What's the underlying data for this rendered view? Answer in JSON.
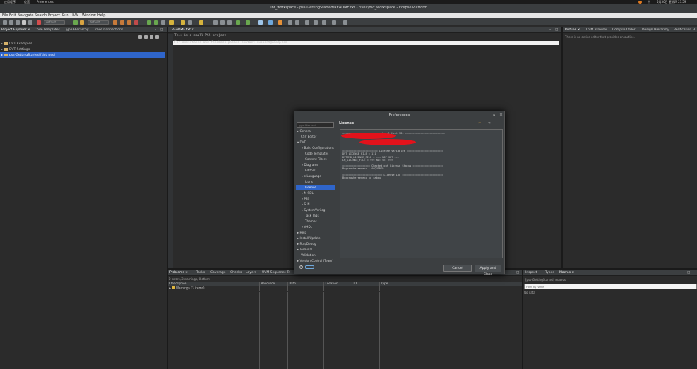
{
  "system_bar": {
    "left_items": [
      "应用程序",
      "位置",
      "Preferences"
    ],
    "right_items": [
      "中",
      "5月30日 星期四 23∶59"
    ]
  },
  "window": {
    "title": "lint_workspace - pss-GettingStarted/README.txt - riveit/dvt_workspace - Eclipse Platform"
  },
  "menu": [
    "File",
    "Edit",
    "Navigate",
    "Search",
    "Project",
    "Run",
    "UVM",
    "Window",
    "Help"
  ],
  "toolbar": {
    "combo_left": "default",
    "combo_mid": "default"
  },
  "left_panel": {
    "tabs": [
      "Project Explorer ×",
      "Code Templates",
      "Type Hierarchy",
      "Trace Connections"
    ],
    "tree": [
      {
        "label": "DVT Examples",
        "selected": false
      },
      {
        "label": "DVT Settings",
        "selected": false
      },
      {
        "label": "pss-GettingStarted [dvt_pss]",
        "selected": true
      }
    ]
  },
  "editor": {
    "tab": "README.txt ×",
    "lines": [
      "This is a small PSS project.",
      "For assistance and feedback please contact support@amiq.com"
    ]
  },
  "right_panel": {
    "tabs": [
      "Outline ×",
      "UVM Browser",
      "Compile Order",
      "Design Hierarchy",
      "Verification H"
    ],
    "message": "There is no active editor that provides an outline."
  },
  "bottom_panel": {
    "tabs": [
      "Problems ×",
      "Tasks",
      "Coverage",
      "Checks",
      "Layers",
      "UVM Sequence Tr"
    ],
    "summary": "0 errors, 3 warnings, 0 others",
    "columns": [
      "Description",
      "Resource",
      "Path",
      "Location",
      "ID",
      "Type"
    ],
    "rows": [
      {
        "description": "Warnings (3 items)"
      }
    ]
  },
  "bottom_right_panel": {
    "tabs": [
      "Inspect",
      "Types",
      "Macros ×"
    ],
    "project_label": "[pss-GettingStarted] macros",
    "filter_placeholder": "Filter by name",
    "empty_text": "No data"
  },
  "dialog": {
    "title": "Preferences",
    "filter_placeholder": "type filter text",
    "page_title": "License",
    "tree": [
      {
        "label": "General",
        "level": 0,
        "arrow": "▸"
      },
      {
        "label": "CSV Editor",
        "level": 0,
        "arrow": ""
      },
      {
        "label": "DVT",
        "level": 0,
        "arrow": "▾"
      },
      {
        "label": "Build Configurations",
        "level": 1,
        "arrow": "▸"
      },
      {
        "label": "Code Templates",
        "level": 1,
        "arrow": ""
      },
      {
        "label": "Content Filters",
        "level": 1,
        "arrow": ""
      },
      {
        "label": "Diagrams",
        "level": 1,
        "arrow": "▸"
      },
      {
        "label": "Editors",
        "level": 1,
        "arrow": ""
      },
      {
        "label": "e Language",
        "level": 1,
        "arrow": "▸"
      },
      {
        "label": "Icons",
        "level": 1,
        "arrow": ""
      },
      {
        "label": "License",
        "level": 1,
        "arrow": "",
        "selected": true
      },
      {
        "label": "M-SDL",
        "level": 1,
        "arrow": "▸"
      },
      {
        "label": "PSS",
        "level": 1,
        "arrow": "▸"
      },
      {
        "label": "SLN",
        "level": 1,
        "arrow": "▸"
      },
      {
        "label": "SystemVerilog",
        "level": 1,
        "arrow": "▸"
      },
      {
        "label": "Task Tags",
        "level": 1,
        "arrow": ""
      },
      {
        "label": "Themes",
        "level": 1,
        "arrow": ""
      },
      {
        "label": "VHDL",
        "level": 1,
        "arrow": "▸"
      },
      {
        "label": "Help",
        "level": 0,
        "arrow": "▸"
      },
      {
        "label": "Install/Update",
        "level": 0,
        "arrow": "▸"
      },
      {
        "label": "Run/Debug",
        "level": 0,
        "arrow": "▸"
      },
      {
        "label": "Terminal",
        "level": 0,
        "arrow": "▸"
      },
      {
        "label": "Validation",
        "level": 0,
        "arrow": ""
      },
      {
        "label": "Version Control (Team)",
        "level": 0,
        "arrow": "▸"
      }
    ],
    "license_text": [
      "========================= Local Host IDs ==========================",
      "",
      "",
      "",
      "",
      "",
      "======================= License Variables ========================",
      "DVT_LICENSE_FILE = 111",
      "DVTCMD_LICENSE_FILE = <<< NOT SET >>>",
      "LM_LICENSE_FILE = <<< NOT SET >>>",
      "",
      "================== Checked-out License Status ====================",
      "Bugcrasherseneko : ACQUIRED",
      "",
      "========================== License Log ===========================",
      "Bugcrasherseneko no xabau"
    ],
    "cancel": "Cancel",
    "apply_close": "Apply and Close"
  }
}
